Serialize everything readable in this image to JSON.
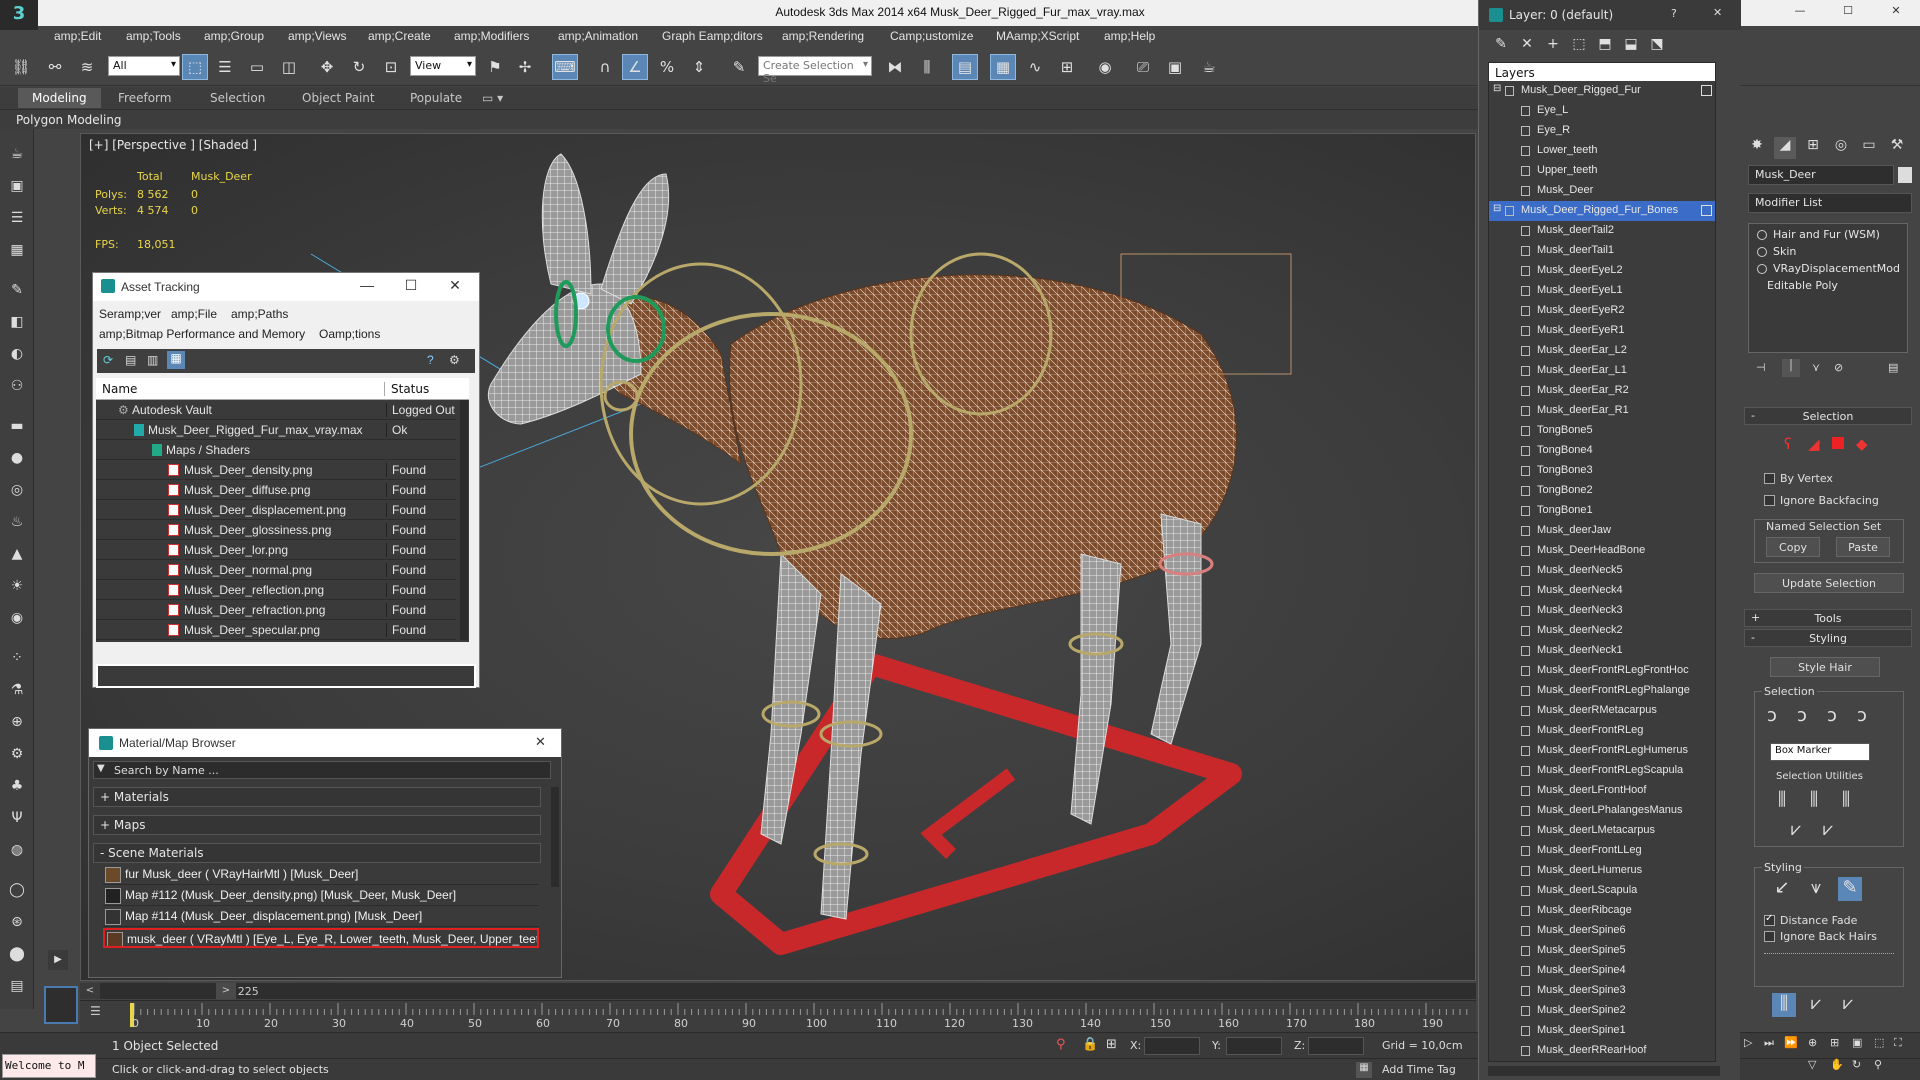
{
  "window": {
    "app_title": "Autodesk 3ds Max  2014 x64     Musk_Deer_Rigged_Fur_max_vray.max",
    "logo_glyph": "3",
    "minimize": "—",
    "maximize": "☐",
    "close": "✕"
  },
  "menu": [
    "amp;Edit",
    "amp;Tools",
    "amp;Group",
    "amp;Views",
    "amp;Create",
    "amp;Modifiers",
    "amp;Animation",
    "Graph Eamp;ditors",
    "amp;Rendering",
    "Camp;ustomize",
    "MAamp;XScript",
    "amp;Help"
  ],
  "toolbar": {
    "filter_value": "All",
    "view_value": "View",
    "selection_set_placeholder": "Create Selection Se"
  },
  "ribbon": {
    "tabs": [
      "Modeling",
      "Freeform",
      "Selection",
      "Object Paint",
      "Populate"
    ],
    "active_tab": "Modeling",
    "sub_label": "Polygon Modeling"
  },
  "viewport": {
    "label": "[+] [Perspective ] [Shaded ]",
    "stats": {
      "col_total": "Total",
      "col_object": "Musk_Deer",
      "polys_label": "Polys:",
      "polys_total": "8 562",
      "polys_obj": "0",
      "verts_label": "Verts:",
      "verts_total": "4 574",
      "verts_obj": "0",
      "fps_label": "FPS:",
      "fps_value": "18,051"
    }
  },
  "asset_tracking": {
    "title": "Asset Tracking",
    "menu_line1": [
      "Seramp;ver",
      "amp;File",
      "amp;Paths"
    ],
    "menu_line2": [
      "amp;Bitmap Performance and Memory",
      "Oamp;tions"
    ],
    "col_name": "Name",
    "col_status": "Status",
    "rows": [
      {
        "name": "Autodesk Vault",
        "status": "Logged Out ..",
        "indent": 1
      },
      {
        "name": "Musk_Deer_Rigged_Fur_max_vray.max",
        "status": "Ok",
        "indent": 2
      },
      {
        "name": "Maps / Shaders",
        "status": "",
        "indent": 3
      },
      {
        "name": "Musk_Deer_density.png",
        "status": "Found",
        "indent": 4
      },
      {
        "name": "Musk_Deer_diffuse.png",
        "status": "Found",
        "indent": 4
      },
      {
        "name": "Musk_Deer_displacement.png",
        "status": "Found",
        "indent": 4
      },
      {
        "name": "Musk_Deer_glossiness.png",
        "status": "Found",
        "indent": 4
      },
      {
        "name": "Musk_Deer_lor.png",
        "status": "Found",
        "indent": 4
      },
      {
        "name": "Musk_Deer_normal.png",
        "status": "Found",
        "indent": 4
      },
      {
        "name": "Musk_Deer_reflection.png",
        "status": "Found",
        "indent": 4
      },
      {
        "name": "Musk_Deer_refraction.png",
        "status": "Found",
        "indent": 4
      },
      {
        "name": "Musk_Deer_specular.png",
        "status": "Found",
        "indent": 4
      }
    ]
  },
  "material_browser": {
    "title": "Material/Map Browser",
    "search_placeholder": "Search by Name ...",
    "sections": [
      "+ Materials",
      "+ Maps",
      "- Scene Materials"
    ],
    "items": [
      "fur Musk_deer  ( VRayHairMtl ) [Musk_Deer]",
      "Map #112 (Musk_Deer_density.png) [Musk_Deer, Musk_Deer]",
      "Map #114 (Musk_Deer_displacement.png) [Musk_Deer]",
      "musk_deer  ( VRayMtl ) [Eye_L, Eye_R, Lower_teeth, Musk_Deer, Upper_teeth]"
    ]
  },
  "timeline": {
    "frame_label": "0 / 225",
    "ticks": [
      "0",
      "10",
      "20",
      "30",
      "40",
      "50",
      "60",
      "70",
      "80",
      "90",
      "100",
      "110",
      "120",
      "130",
      "140",
      "150",
      "160",
      "170",
      "180",
      "190"
    ]
  },
  "status": {
    "welcome": "Welcome to M",
    "selected": "1 Object Selected",
    "prompt": "Click or click-and-drag to select objects",
    "x_label": "X:",
    "y_label": "Y:",
    "z_label": "Z:",
    "grid": "Grid = 10,0cm",
    "add_time_tag": "Add Time Tag"
  },
  "layers": {
    "title": "Layer: 0 (default)",
    "help": "?",
    "close": "✕",
    "header": "Layers",
    "rows": [
      {
        "name": "Musk_Deer_Rigged_Fur",
        "level": 0,
        "selected": false,
        "box": true
      },
      {
        "name": "Eye_L",
        "level": 1
      },
      {
        "name": "Eye_R",
        "level": 1
      },
      {
        "name": "Lower_teeth",
        "level": 1
      },
      {
        "name": "Upper_teeth",
        "level": 1
      },
      {
        "name": "Musk_Deer",
        "level": 1
      },
      {
        "name": "Musk_Deer_Rigged_Fur_Bones",
        "level": 0,
        "selected": true,
        "box": true
      },
      {
        "name": "Musk_deerTail2",
        "level": 1
      },
      {
        "name": "Musk_deerTail1",
        "level": 1
      },
      {
        "name": "Musk_deerEyeL2",
        "level": 1
      },
      {
        "name": "Musk_deerEyeL1",
        "level": 1
      },
      {
        "name": "Musk_deerEyeR2",
        "level": 1
      },
      {
        "name": "Musk_deerEyeR1",
        "level": 1
      },
      {
        "name": "Musk_deerEar_L2",
        "level": 1
      },
      {
        "name": "Musk_deerEar_L1",
        "level": 1
      },
      {
        "name": "Musk_deerEar_R2",
        "level": 1
      },
      {
        "name": "Musk_deerEar_R1",
        "level": 1
      },
      {
        "name": "TongBone5",
        "level": 1
      },
      {
        "name": "TongBone4",
        "level": 1
      },
      {
        "name": "TongBone3",
        "level": 1
      },
      {
        "name": "TongBone2",
        "level": 1
      },
      {
        "name": "TongBone1",
        "level": 1
      },
      {
        "name": "Musk_deerJaw",
        "level": 1
      },
      {
        "name": "Musk_DeerHeadBone",
        "level": 1
      },
      {
        "name": "Musk_deerNeck5",
        "level": 1
      },
      {
        "name": "Musk_deerNeck4",
        "level": 1
      },
      {
        "name": "Musk_deerNeck3",
        "level": 1
      },
      {
        "name": "Musk_deerNeck2",
        "level": 1
      },
      {
        "name": "Musk_deerNeck1",
        "level": 1
      },
      {
        "name": "Musk_deerFrontRLegFrontHoc",
        "level": 1
      },
      {
        "name": "Musk_deerFrontRLegPhalange",
        "level": 1
      },
      {
        "name": "Musk_deerRMetacarpus",
        "level": 1
      },
      {
        "name": "Musk_deerFrontRLeg",
        "level": 1
      },
      {
        "name": "Musk_deerFrontRLegHumerus",
        "level": 1
      },
      {
        "name": "Musk_deerFrontRLegScapula",
        "level": 1
      },
      {
        "name": "Musk_deerLFrontHoof",
        "level": 1
      },
      {
        "name": "Musk_deerLPhalangesManus",
        "level": 1
      },
      {
        "name": "Musk_deerLMetacarpus",
        "level": 1
      },
      {
        "name": "Musk_deerFrontLLeg",
        "level": 1
      },
      {
        "name": "Musk_deerLHumerus",
        "level": 1
      },
      {
        "name": "Musk_deerLScapula",
        "level": 1
      },
      {
        "name": "Musk_deerRibcage",
        "level": 1
      },
      {
        "name": "Musk_deerSpine6",
        "level": 1
      },
      {
        "name": "Musk_deerSpine5",
        "level": 1
      },
      {
        "name": "Musk_deerSpine4",
        "level": 1
      },
      {
        "name": "Musk_deerSpine3",
        "level": 1
      },
      {
        "name": "Musk_deerSpine2",
        "level": 1
      },
      {
        "name": "Musk_deerSpine1",
        "level": 1
      },
      {
        "name": "Musk_deerRRearHoof",
        "level": 1
      }
    ]
  },
  "command_panel": {
    "object_name": "Musk_Deer",
    "modifier_list": "Modifier List",
    "stack": [
      "Hair and Fur (WSM)",
      "Skin",
      "VRayDisplacementMod",
      "Editable Poly"
    ],
    "selection_rollout": "Selection",
    "by_vertex": "By Vertex",
    "ignore_backfacing": "Ignore Backfacing",
    "named_selection_set": "Named Selection Set",
    "copy": "Copy",
    "paste": "Paste",
    "update_selection": "Update Selection",
    "tools_rollout": "Tools",
    "styling_rollout": "Styling",
    "style_hair": "Style Hair",
    "selection_group": "Selection",
    "box_marker": "Box Marker",
    "selection_utilities": "Selection Utilities",
    "styling_group": "Styling",
    "distance_fade": "Distance Fade",
    "ignore_back_hairs": "Ignore Back Hairs"
  },
  "colors": {
    "accent_blue": "#3a6cc8",
    "found_red": "#e02020",
    "stats_yellow": "#e8d64a",
    "fur_brown": "#7a4a2a",
    "ground_red": "#c8282a"
  }
}
